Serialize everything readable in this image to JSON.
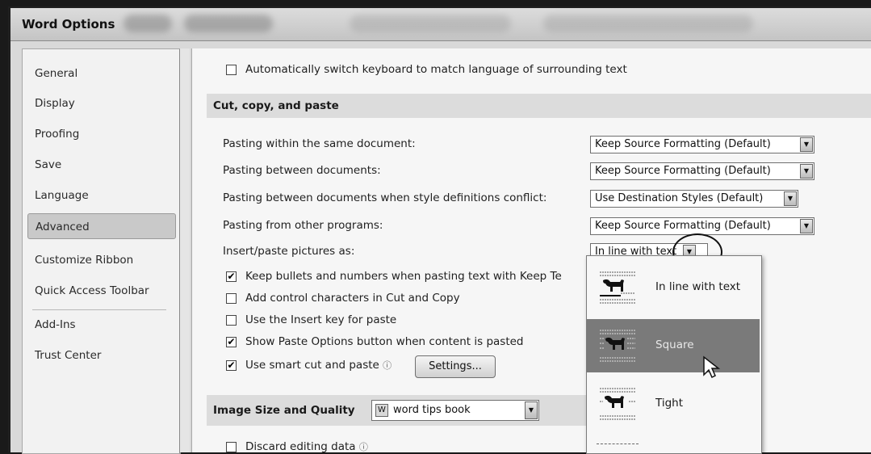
{
  "window": {
    "title": "Word Options"
  },
  "sidebar": {
    "items": [
      {
        "label": "General"
      },
      {
        "label": "Display"
      },
      {
        "label": "Proofing"
      },
      {
        "label": "Save"
      },
      {
        "label": "Language"
      },
      {
        "label": "Advanced"
      },
      {
        "label": "Customize Ribbon"
      },
      {
        "label": "Quick Access Toolbar"
      },
      {
        "label": "Add-Ins"
      },
      {
        "label": "Trust Center"
      }
    ],
    "active": "Advanced"
  },
  "top_option": {
    "label": "Automatically switch keyboard to match language of surrounding text",
    "checked": false
  },
  "cut_copy_paste": {
    "header": "Cut, copy, and paste",
    "settings": [
      {
        "label": "Pasting within the same document:",
        "value": "Keep Source Formatting (Default)"
      },
      {
        "label": "Pasting between documents:",
        "value": "Keep Source Formatting (Default)"
      },
      {
        "label": "Pasting between documents when style definitions conflict:",
        "value": "Use Destination Styles (Default)"
      },
      {
        "label": "Pasting from other programs:",
        "value": "Keep Source Formatting (Default)"
      },
      {
        "label": "Insert/paste pictures as:",
        "value": "In line with text"
      }
    ],
    "checkboxes": [
      {
        "label": "Keep bullets and numbers when pasting text with Keep Te",
        "checked": true
      },
      {
        "label": "Add control characters in Cut and Copy",
        "checked": false
      },
      {
        "label": "Use the Insert key for paste",
        "checked": false
      },
      {
        "label": "Show Paste Options button when content is pasted",
        "checked": true
      },
      {
        "label": "Use smart cut and paste",
        "checked": true
      }
    ],
    "settings_button": "Settings..."
  },
  "image_size": {
    "header": "Image Size and Quality",
    "document": "word tips book",
    "discard_label": "Discard editing data",
    "discard_checked": false
  },
  "dropdown": {
    "options": [
      {
        "label": "In line with text",
        "selected": false
      },
      {
        "label": "Square",
        "selected": true
      },
      {
        "label": "Tight",
        "selected": false
      }
    ]
  },
  "glyphs": {
    "check": "✔",
    "arrow": "▼",
    "info": "ⓘ"
  }
}
